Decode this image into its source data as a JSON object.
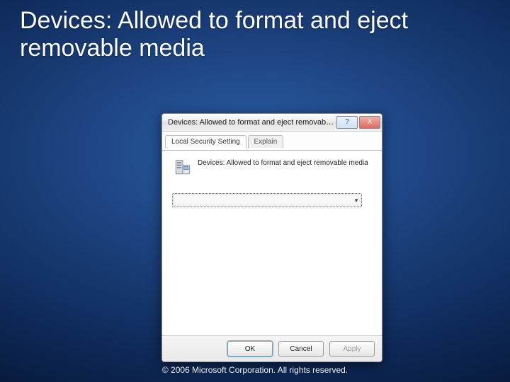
{
  "slide": {
    "heading": "Devices: Allowed to format and eject removable media",
    "copyright": "© 2006 Microsoft Corporation. All rights reserved."
  },
  "dialog": {
    "title": "Devices: Allowed to format and eject removable media Propert...",
    "help_label": "?",
    "close_label": "X",
    "tabs": {
      "active": "Local Security Setting",
      "inactive": "Explain"
    },
    "policy_text": "Devices: Allowed to format and eject removable media",
    "dropdown_value": "",
    "buttons": {
      "ok": "OK",
      "cancel": "Cancel",
      "apply": "Apply"
    }
  }
}
